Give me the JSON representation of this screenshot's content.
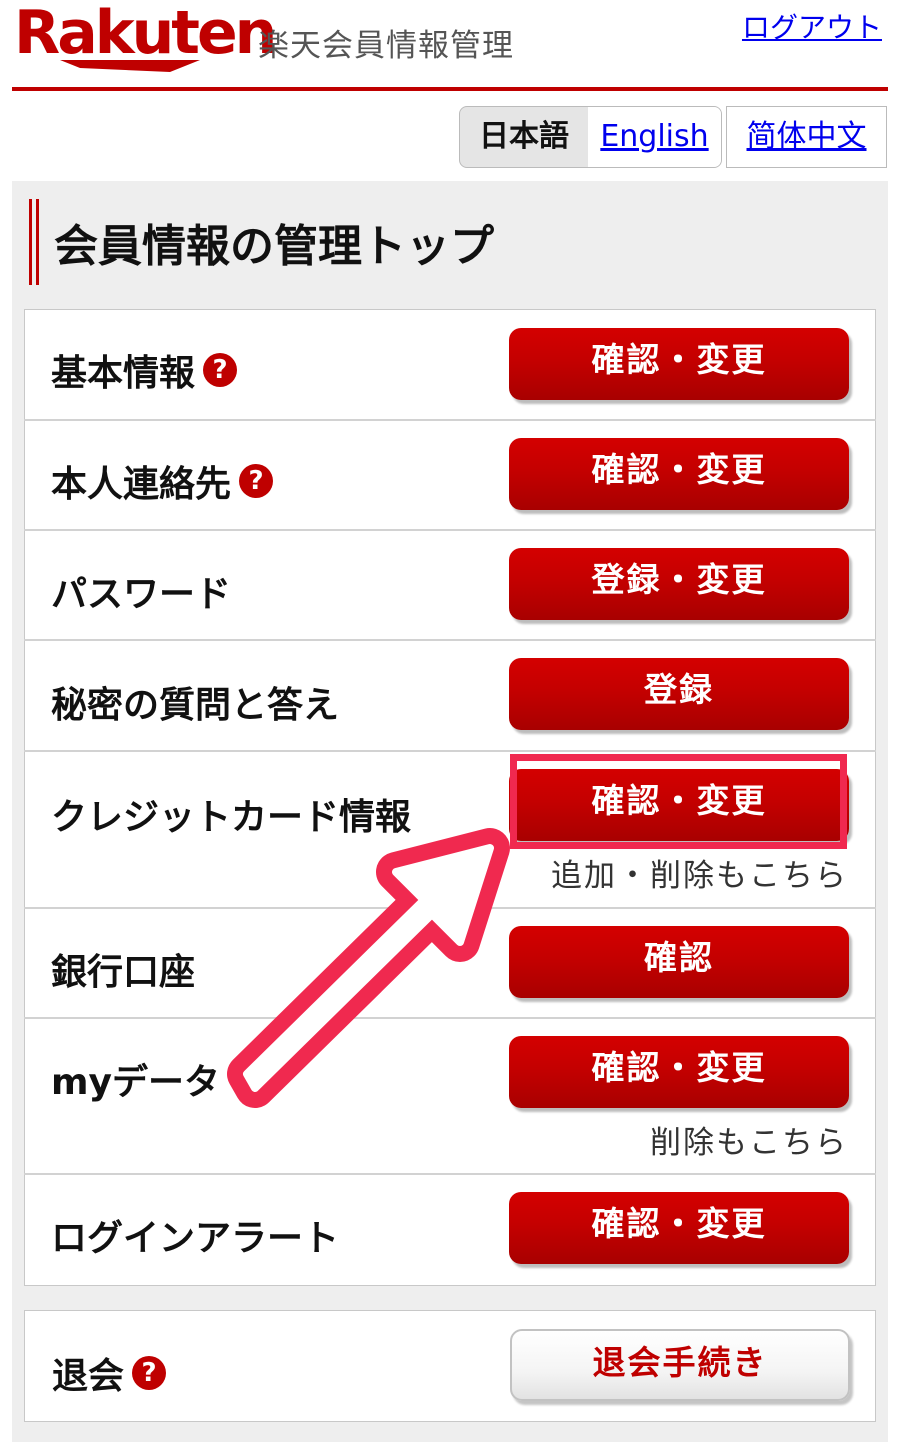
{
  "header": {
    "logo_text": "Rakuten",
    "site_title": "楽天会員情報管理",
    "logout_label": "ログアウト"
  },
  "languages": {
    "current": "日本語",
    "english": "English",
    "chinese": "简体中文"
  },
  "page_title": "会員情報の管理トップ",
  "menu": [
    {
      "label": "基本情報",
      "help": true,
      "button": "確認・変更",
      "note": ""
    },
    {
      "label": "本人連絡先",
      "help": true,
      "button": "確認・変更",
      "note": ""
    },
    {
      "label": "パスワード",
      "help": false,
      "button": "登録・変更",
      "note": ""
    },
    {
      "label": "秘密の質問と答え",
      "help": false,
      "button": "登録",
      "note": ""
    },
    {
      "label": "クレジットカード情報",
      "help": false,
      "button": "確認・変更",
      "note": "追加・削除もこちら",
      "highlighted": true
    },
    {
      "label": "銀行口座",
      "help": false,
      "button": "確認",
      "note": ""
    },
    {
      "label": "myデータ",
      "help": false,
      "button": "確認・変更",
      "note": "削除もこちら"
    },
    {
      "label": "ログインアラート",
      "help": false,
      "button": "確認・変更",
      "note": ""
    }
  ],
  "withdraw": {
    "label": "退会",
    "help": true,
    "button": "退会手続き"
  },
  "help_icon_glyph": "?",
  "colors": {
    "brand_red": "#bf0000",
    "annotation_pink": "#f0294f"
  }
}
